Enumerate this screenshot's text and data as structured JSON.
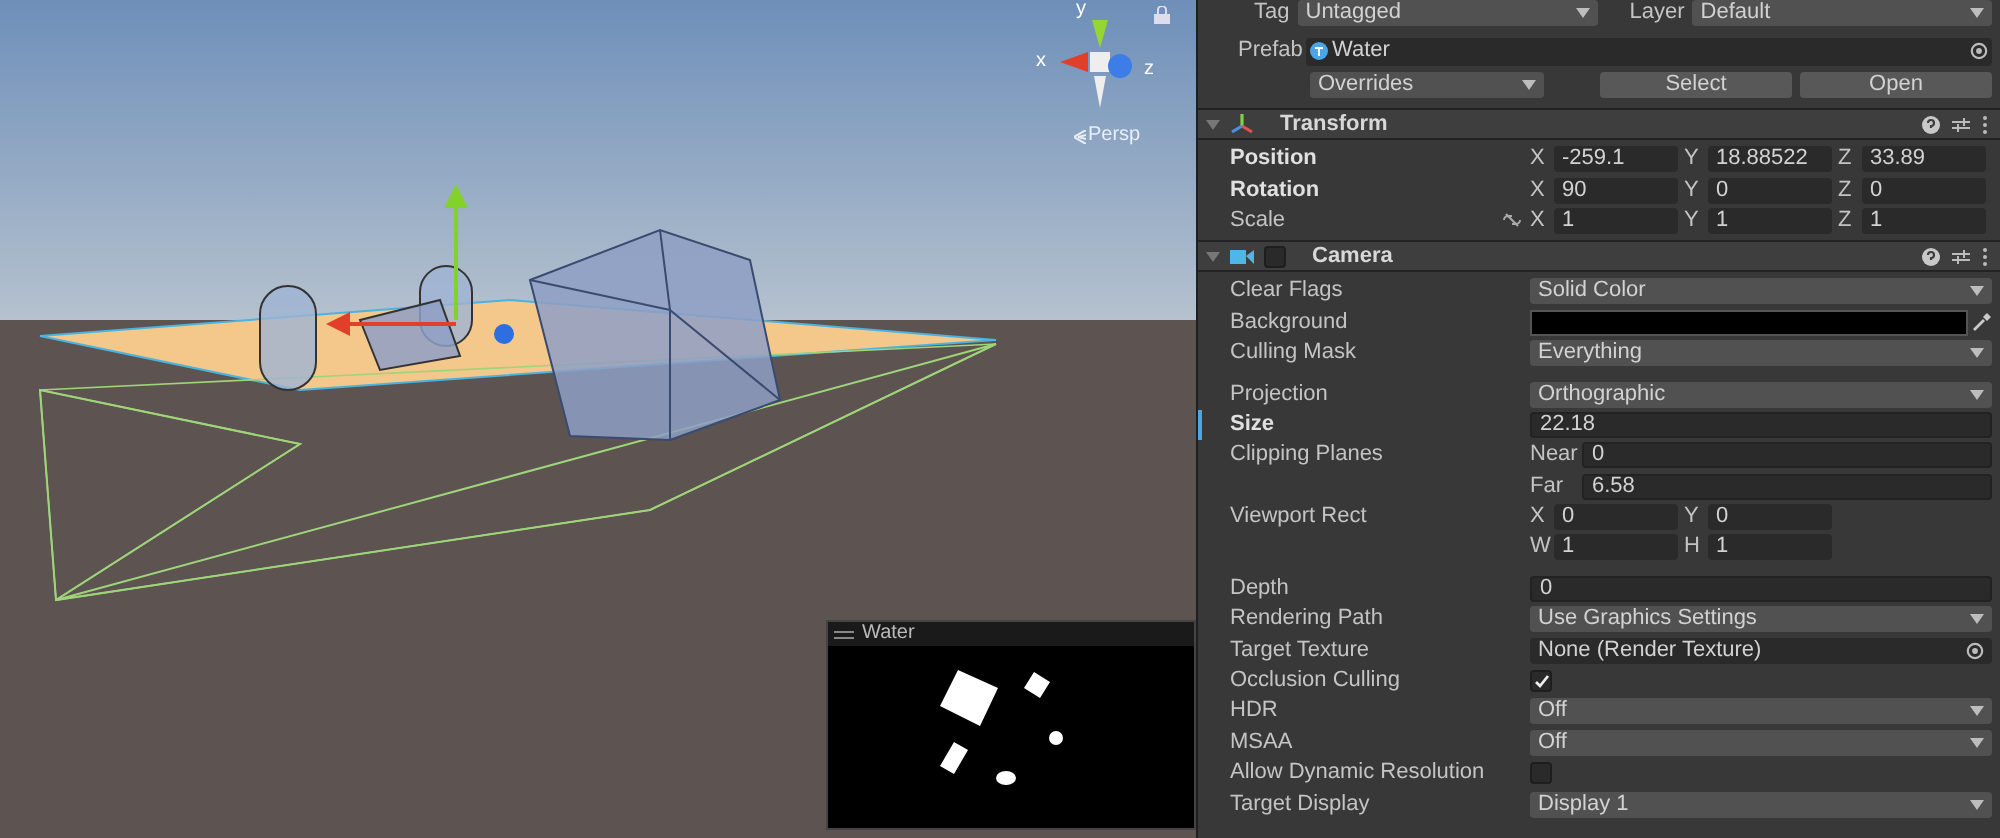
{
  "scene": {
    "gizmo_labels": {
      "y": "y",
      "x": "x",
      "z": "z"
    },
    "view_mode": "Persp"
  },
  "game_view": {
    "title": "Water"
  },
  "inspector": {
    "top_row": {
      "tag_label": "Tag",
      "tag_value": "Untagged",
      "layer_label": "Layer",
      "layer_value": "Default"
    },
    "prefab": {
      "label": "Prefab",
      "value": "Water",
      "overrides": "Overrides",
      "buttons": [
        "Select",
        "Open"
      ]
    },
    "components": [
      {
        "name": "Transform",
        "kind": "transform",
        "expanded": true,
        "rows": [
          {
            "kind": "vector",
            "label": "Position",
            "bold": true,
            "fields": [
              {
                "axis": "X",
                "value": "-259.1"
              },
              {
                "axis": "Y",
                "value": "18.88522"
              },
              {
                "axis": "Z",
                "value": "33.89"
              }
            ]
          },
          {
            "kind": "vector",
            "label": "Rotation",
            "bold": true,
            "fields": [
              {
                "axis": "X",
                "value": "90"
              },
              {
                "axis": "Y",
                "value": "0"
              },
              {
                "axis": "Z",
                "value": "0"
              }
            ]
          },
          {
            "kind": "vector",
            "label": "Scale",
            "bold": false,
            "linked": true,
            "fields": [
              {
                "axis": "X",
                "value": "1"
              },
              {
                "axis": "Y",
                "value": "1"
              },
              {
                "axis": "Z",
                "value": "1"
              }
            ]
          }
        ]
      },
      {
        "name": "Camera",
        "kind": "camera",
        "expanded": true,
        "enabled": false,
        "rows": [
          {
            "kind": "dropdown",
            "label": "Clear Flags",
            "value": "Solid Color"
          },
          {
            "kind": "color",
            "label": "Background",
            "color": "#000000"
          },
          {
            "kind": "dropdown",
            "label": "Culling Mask",
            "value": "Everything"
          },
          {
            "kind": "dropdown",
            "label": "Projection",
            "value": "Orthographic",
            "gap_before": true
          },
          {
            "kind": "field",
            "label": "Size",
            "value": "22.18",
            "bold": true,
            "marker": true
          },
          {
            "kind": "field",
            "label": "Clipping Planes",
            "prefix": "Near",
            "value": "0"
          },
          {
            "kind": "field",
            "prefix": "Far",
            "value": "6.58"
          },
          {
            "kind": "vector",
            "label": "Viewport Rect",
            "fields": [
              {
                "axis": "X",
                "value": "0"
              },
              {
                "axis": "Y",
                "value": "0"
              }
            ]
          },
          {
            "kind": "vector",
            "fields": [
              {
                "axis": "W",
                "value": "1"
              },
              {
                "axis": "H",
                "value": "1"
              }
            ]
          },
          {
            "kind": "field",
            "label": "Depth",
            "value": "0",
            "gap_before": true
          },
          {
            "kind": "dropdown",
            "label": "Rendering Path",
            "value": "Use Graphics Settings"
          },
          {
            "kind": "object",
            "label": "Target Texture",
            "value": "None (Render Texture)"
          },
          {
            "kind": "checkbox",
            "label": "Occlusion Culling",
            "checked": true
          },
          {
            "kind": "dropdown",
            "label": "HDR",
            "value": "Off"
          },
          {
            "kind": "dropdown",
            "label": "MSAA",
            "value": "Off"
          },
          {
            "kind": "checkbox",
            "label": "Allow Dynamic Resolution",
            "checked": false
          },
          {
            "kind": "dropdown",
            "label": "Target Display",
            "value": "Display 1"
          }
        ]
      }
    ]
  }
}
